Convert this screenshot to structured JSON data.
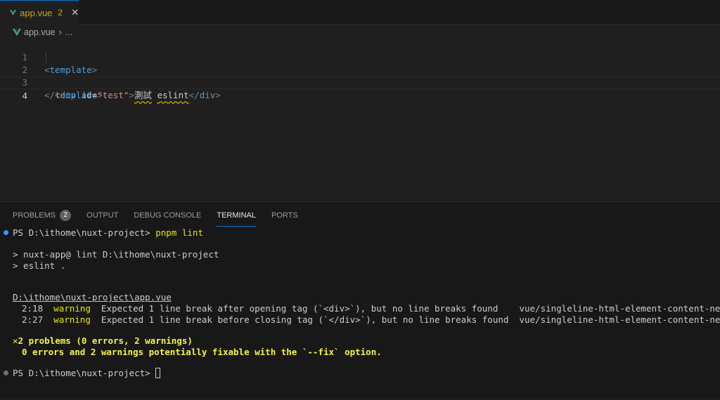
{
  "tab": {
    "filename": "app.vue",
    "problem_count": "2",
    "close": "✕"
  },
  "breadcrumb": {
    "file": "app.vue",
    "separator": "›",
    "more": "..."
  },
  "editor": {
    "lines": [
      {
        "number": "1"
      },
      {
        "number": "2"
      },
      {
        "number": "3"
      },
      {
        "number": "4"
      }
    ],
    "code": {
      "l1_open": "<",
      "l1_tag": "template",
      "l1_close": ">",
      "l2_open": "<",
      "l2_tag": "div",
      "l2_attr": "id",
      "l2_eq": "=",
      "l2_str": "\"test\"",
      "l2_close": ">",
      "l2_text1": "測試",
      "l2_space": " ",
      "l2_text2": "eslint",
      "l2_end_open": "</",
      "l2_end_tag": "div",
      "l2_end_close": ">",
      "l3_open": "</",
      "l3_tag": "template",
      "l3_close": ">"
    }
  },
  "panel": {
    "tabs": [
      {
        "label": "PROBLEMS",
        "badge": "2"
      },
      {
        "label": "OUTPUT"
      },
      {
        "label": "DEBUG CONSOLE"
      },
      {
        "label": "TERMINAL"
      },
      {
        "label": "PORTS"
      }
    ],
    "active_tab": "TERMINAL"
  },
  "terminal": {
    "prompt1": "PS D:\\ithome\\nuxt-project> ",
    "command": "pnpm lint",
    "out1": "> nuxt-app@ lint D:\\ithome\\nuxt-project",
    "out2": "> eslint .",
    "file_path": "D:\\ithome\\nuxt-project\\app.vue",
    "warnings": [
      {
        "pos": "2:18",
        "level": "warning",
        "message": "Expected 1 line break after opening tag (`<div>`), but no line breaks found",
        "rule": "vue/singleline-html-element-content-newline"
      },
      {
        "pos": "2:27",
        "level": "warning",
        "message": "Expected 1 line break before closing tag (`</div>`), but no line breaks found",
        "rule": "vue/singleline-html-element-content-newline"
      }
    ],
    "summary_icon": "✕",
    "summary": "2 problems (0 errors, 2 warnings)",
    "fixable": "0 errors and 2 warnings potentially fixable with the `--fix` option.",
    "prompt2": "PS D:\\ithome\\nuxt-project> "
  },
  "colors": {
    "accent": "#0078d4",
    "warning": "#cca700",
    "terminal_yellow": "#e5e510",
    "error": "#f14c4c"
  }
}
